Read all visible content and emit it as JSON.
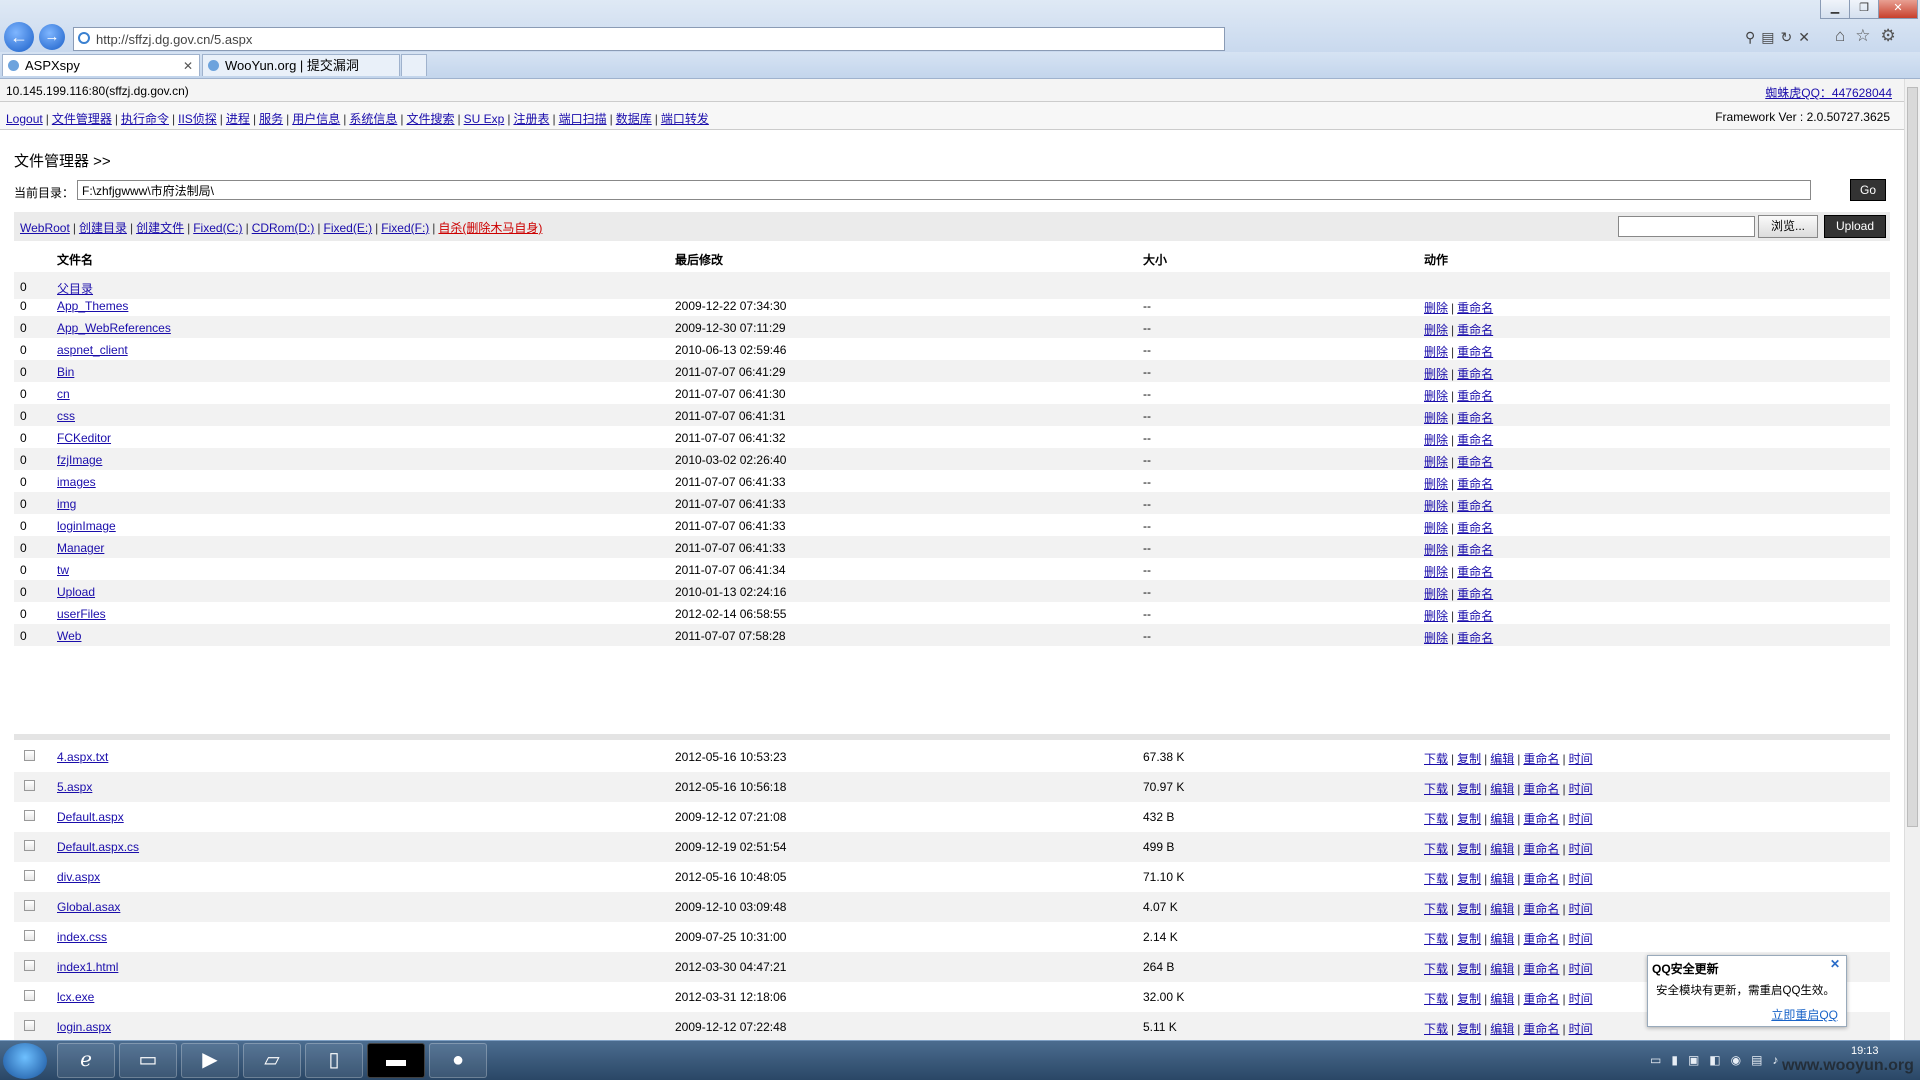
{
  "browser": {
    "url": "http://sffzj.dg.gov.cn/5.aspx",
    "tabs": [
      {
        "label": "ASPXspy",
        "active": true
      },
      {
        "label": "WooYun.org | 提交漏洞",
        "active": false
      }
    ]
  },
  "header": {
    "host": "10.145.199.116:80(sffzj.dg.gov.cn)",
    "qq_link": "蜘蛛虎QQ：447628044"
  },
  "menu": {
    "items": [
      "Logout",
      "文件管理器",
      "执行命令",
      "IIS侦探",
      "进程",
      "服务",
      "用户信息",
      "系统信息",
      "文件搜索",
      "SU Exp",
      "注册表",
      "端口扫描",
      "数据库",
      "端口转发"
    ],
    "framework": "Framework Ver : 2.0.50727.3625"
  },
  "fm": {
    "title": "文件管理器 >>",
    "curdir_label": "当前目录：",
    "curdir_value": "F:\\zhfjgwww\\市府法制局\\",
    "go": "Go",
    "tools": [
      "WebRoot",
      "创建目录",
      "创建文件",
      "Fixed(C:)",
      "CDRom(D:)",
      "Fixed(E:)",
      "Fixed(F:)"
    ],
    "self_delete": "自杀(删除木马自身)",
    "browse": "浏览...",
    "upload": "Upload"
  },
  "table": {
    "headers": [
      "文件名",
      "最后修改",
      "大小",
      "动作"
    ],
    "parent": {
      "num": "0",
      "name": "父目录"
    },
    "dir_actions": [
      "删除",
      "重命名"
    ],
    "dirs": [
      {
        "num": "0",
        "name": "App_Themes",
        "date": "2009-12-22 07:34:30",
        "size": "--"
      },
      {
        "num": "0",
        "name": "App_WebReferences",
        "date": "2009-12-30 07:11:29",
        "size": "--"
      },
      {
        "num": "0",
        "name": "aspnet_client",
        "date": "2010-06-13 02:59:46",
        "size": "--"
      },
      {
        "num": "0",
        "name": "Bin",
        "date": "2011-07-07 06:41:29",
        "size": "--"
      },
      {
        "num": "0",
        "name": "cn",
        "date": "2011-07-07 06:41:30",
        "size": "--"
      },
      {
        "num": "0",
        "name": "css",
        "date": "2011-07-07 06:41:31",
        "size": "--"
      },
      {
        "num": "0",
        "name": "FCKeditor",
        "date": "2011-07-07 06:41:32",
        "size": "--"
      },
      {
        "num": "0",
        "name": "fzjImage",
        "date": "2010-03-02 02:26:40",
        "size": "--"
      },
      {
        "num": "0",
        "name": "images",
        "date": "2011-07-07 06:41:33",
        "size": "--"
      },
      {
        "num": "0",
        "name": "img",
        "date": "2011-07-07 06:41:33",
        "size": "--"
      },
      {
        "num": "0",
        "name": "loginImage",
        "date": "2011-07-07 06:41:33",
        "size": "--"
      },
      {
        "num": "0",
        "name": "Manager",
        "date": "2011-07-07 06:41:33",
        "size": "--"
      },
      {
        "num": "0",
        "name": "tw",
        "date": "2011-07-07 06:41:34",
        "size": "--"
      },
      {
        "num": "0",
        "name": "Upload",
        "date": "2010-01-13 02:24:16",
        "size": "--"
      },
      {
        "num": "0",
        "name": "userFiles",
        "date": "2012-02-14 06:58:55",
        "size": "--"
      },
      {
        "num": "0",
        "name": "Web",
        "date": "2011-07-07 07:58:28",
        "size": "--"
      }
    ],
    "file_actions": [
      "下载",
      "复制",
      "编辑",
      "重命名",
      "时间"
    ],
    "files": [
      {
        "name": "4.aspx.txt",
        "date": "2012-05-16 10:53:23",
        "size": "67.38 K"
      },
      {
        "name": "5.aspx",
        "date": "2012-05-16 10:56:18",
        "size": "70.97 K"
      },
      {
        "name": "Default.aspx",
        "date": "2009-12-12 07:21:08",
        "size": "432 B"
      },
      {
        "name": "Default.aspx.cs",
        "date": "2009-12-19 02:51:54",
        "size": "499 B"
      },
      {
        "name": "div.aspx",
        "date": "2012-05-16 10:48:05",
        "size": "71.10 K"
      },
      {
        "name": "Global.asax",
        "date": "2009-12-10 03:09:48",
        "size": "4.07 K"
      },
      {
        "name": "index.css",
        "date": "2009-07-25 10:31:00",
        "size": "2.14 K"
      },
      {
        "name": "index1.html",
        "date": "2012-03-30 04:47:21",
        "size": "264 B"
      },
      {
        "name": "lcx.exe",
        "date": "2012-03-31 12:18:06",
        "size": "32.00 K"
      },
      {
        "name": "login.aspx",
        "date": "2009-12-12 07:22:48",
        "size": "5.11 K"
      }
    ]
  },
  "qq_popup": {
    "title": "QQ安全更新",
    "message": "安全模块有更新，需重启QQ生效。",
    "restart": "立即重启QQ"
  },
  "taskbar": {
    "clock": "19:13"
  },
  "watermark": "www.wooyun.org"
}
